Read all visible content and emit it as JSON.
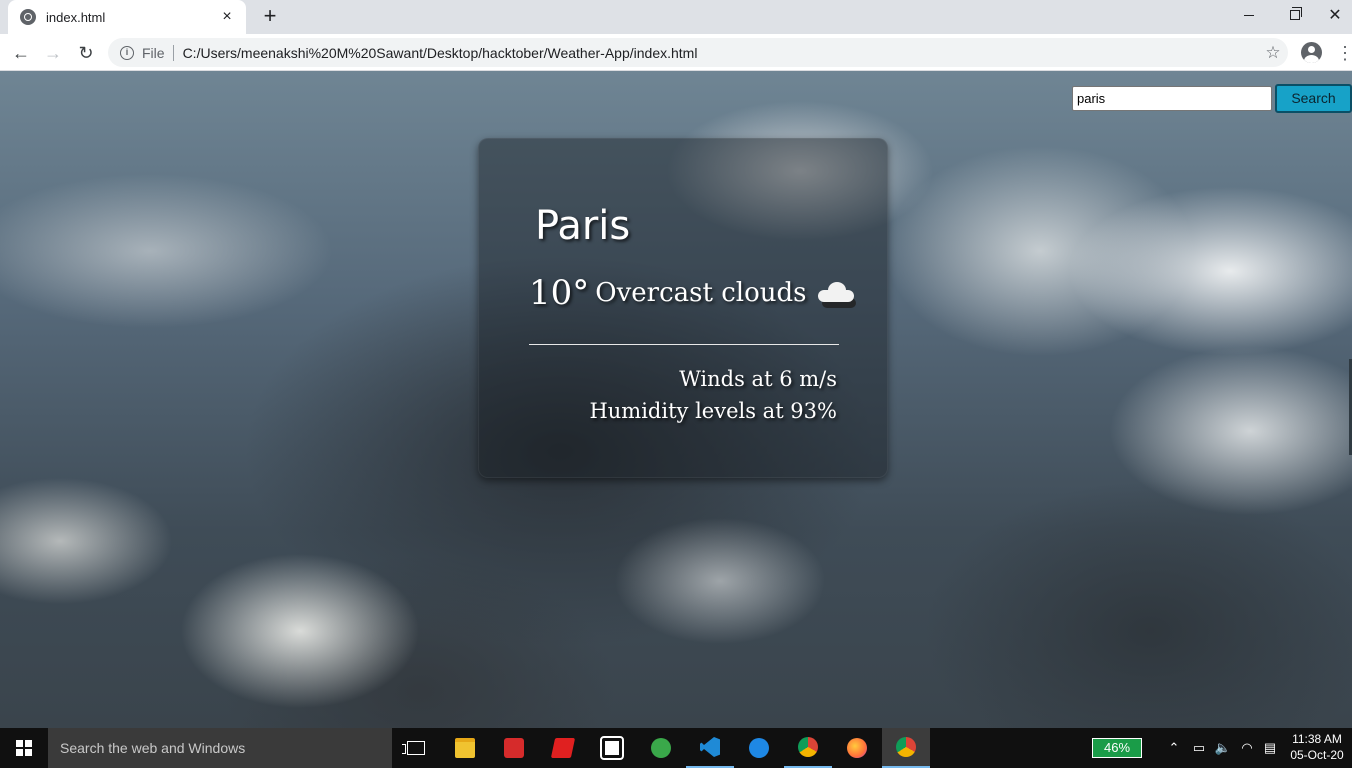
{
  "browser": {
    "tab_title": "index.html",
    "tab_close_glyph": "×",
    "new_tab_glyph": "+",
    "omnibox": {
      "scheme_label": "File",
      "url": "C:/Users/meenakshi%20M%20Sawant/Desktop/hacktober/Weather-App/index.html"
    },
    "icons": [
      "globe-icon",
      "back-arrow-icon",
      "forward-arrow-icon",
      "reload-icon",
      "info-icon",
      "star-icon",
      "profile-icon",
      "menu-dots-icon",
      "minimize-icon",
      "maximize-icon",
      "close-icon"
    ]
  },
  "page": {
    "search": {
      "input_value": "paris",
      "button_label": "Search",
      "button_color": "#17a2c8"
    },
    "weather_card": {
      "city": "Paris",
      "temperature": "10°",
      "description": "Overcast clouds",
      "icon": "cloud-icon",
      "wind": "Winds at 6 m/s",
      "humidity": "Humidity levels at 93%"
    }
  },
  "taskbar": {
    "search_placeholder": "Search the web and Windows",
    "battery_percent": "46%",
    "time": "11:38 AM",
    "date": "05-Oct-20",
    "apps": [
      "task-view-icon",
      "file-explorer-icon",
      "reader-icon",
      "red-app-icon",
      "store-icon",
      "green-app-icon",
      "vscode-icon",
      "edge-icon",
      "chrome-profile-icon",
      "firefox-icon",
      "chrome-icon"
    ],
    "tray_icons": [
      "chevron-up-icon",
      "battery-icon",
      "volume-icon",
      "wifi-icon",
      "notifications-icon"
    ]
  }
}
